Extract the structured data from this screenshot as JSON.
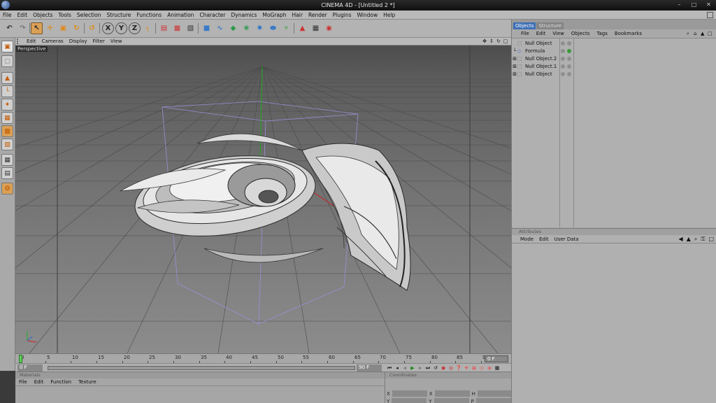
{
  "window": {
    "title": "CINEMA 4D - [Untitled 2 *]"
  },
  "menubar": {
    "items": [
      "File",
      "Edit",
      "Objects",
      "Tools",
      "Selection",
      "Structure",
      "Functions",
      "Animation",
      "Character",
      "Dynamics",
      "MoGraph",
      "Hair",
      "Render",
      "Plugins",
      "Window",
      "Help"
    ]
  },
  "viewport": {
    "menu": [
      "Edit",
      "Cameras",
      "Display",
      "Filter",
      "View"
    ],
    "label": "Perspective"
  },
  "timeline": {
    "ticks": [
      "0",
      "5",
      "10",
      "15",
      "20",
      "25",
      "30",
      "35",
      "40",
      "45",
      "50",
      "55",
      "60",
      "65",
      "70",
      "75",
      "80",
      "85",
      "90"
    ],
    "current_frame": "0 F"
  },
  "transport": {
    "start_frame": "0 F",
    "end_frame": "90 F"
  },
  "materials": {
    "title": "Materials",
    "menu": [
      "File",
      "Edit",
      "Function",
      "Texture"
    ]
  },
  "coordinates": {
    "title": "Coordinates",
    "rows": [
      "X",
      "Y"
    ],
    "right_labels": [
      "H",
      "P"
    ]
  },
  "objects_panel": {
    "tabs": [
      "Objects",
      "Structure"
    ],
    "menu": [
      "File",
      "Edit",
      "View",
      "Objects",
      "Tags",
      "Bookmarks"
    ],
    "items": [
      "Null Object",
      "Formula",
      "Null Object.2",
      "Null Object.1",
      "Null Object"
    ]
  },
  "attributes_panel": {
    "title": "Attributes",
    "menu": [
      "Mode",
      "Edit",
      "User Data"
    ]
  },
  "colors": {
    "accent_orange": "#d97a1c",
    "tab_active": "#3f6fb5",
    "axis_x": "#cc2222",
    "axis_y": "#22aa22",
    "axis_z": "#3366cc"
  }
}
